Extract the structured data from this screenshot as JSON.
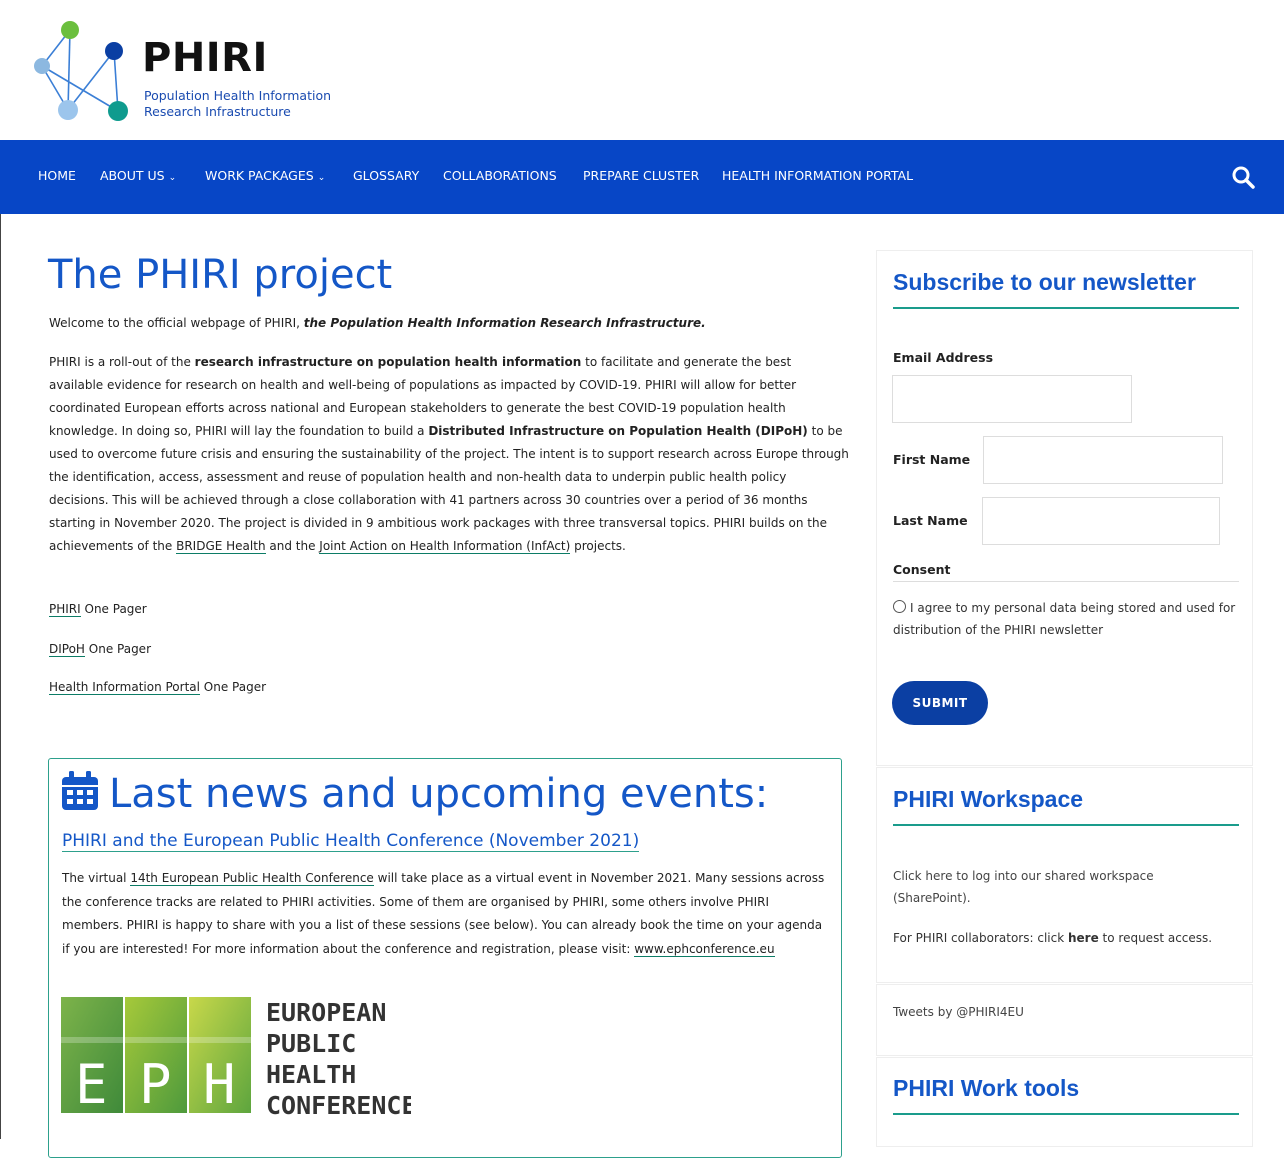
{
  "header": {
    "logo_title": "PHIRI",
    "logo_subtitle_line1": "Population Health Information",
    "logo_subtitle_line2": "Research Infrastructure"
  },
  "nav": {
    "items": [
      {
        "label": "HOME",
        "has_dropdown": false
      },
      {
        "label": "ABOUT US",
        "has_dropdown": true
      },
      {
        "label": "WORK PACKAGES",
        "has_dropdown": true
      },
      {
        "label": "GLOSSARY",
        "has_dropdown": false
      },
      {
        "label": "COLLABORATIONS",
        "has_dropdown": false
      },
      {
        "label": "PREPARE CLUSTER",
        "has_dropdown": false
      },
      {
        "label": "HEALTH INFORMATION PORTAL",
        "has_dropdown": false
      }
    ],
    "chevron": "⌄",
    "search_icon": "search-icon"
  },
  "main": {
    "title": "The PHIRI project",
    "welcome_prefix": "Welcome to the official webpage of PHIRI, ",
    "welcome_emph": "the Population Health Information Research Infrastructure.",
    "para": {
      "t1": "PHIRI is a roll-out of the ",
      "b1": "research infrastructure on population health information",
      "t2": " to facilitate and generate the best available evidence for research on health and well-being of populations as impacted by COVID-19. PHIRI will allow for better coordinated European efforts across national and European stakeholders to generate the best COVID-19 population health knowledge. In doing so, PHIRI will lay the foundation to build a ",
      "b2": "Distributed Infrastructure on Population Health (DIPoH)",
      "t3": " to be used to overcome future crisis and ensuring the sustainability of the project. The intent is to support research across Europe through the identification, access, assessment and reuse of population health and non-health data to underpin public health policy decisions. This will be achieved through a close collaboration with 41 partners across 30 countries over a period of 36 months starting in November 2020. The project is divided in 9 ambitious work packages with three transversal topics. PHIRI builds on the achievements of the ",
      "l1": "BRIDGE Health",
      "t4": " and the ",
      "l2": "Joint Action on Health Information (InfAct)",
      "t5": " projects."
    },
    "one_pagers": [
      {
        "link": "PHIRI",
        "rest": " One Pager"
      },
      {
        "link": "DIPoH",
        "rest": " One Pager"
      },
      {
        "link": "Health Information Portal",
        "rest": " One Pager"
      }
    ]
  },
  "news": {
    "title": "Last news and upcoming events:",
    "icon": "calendar-icon",
    "article_title": "PHIRI and the European Public Health Conference (November 2021)",
    "body_t1": "The virtual ",
    "body_l1": "14th European Public Health Conference",
    "body_t2": " will take place as a virtual event in November 2021. Many sessions across the conference tracks are related to PHIRI activities. Some of them are organised by PHIRI, some others involve PHIRI members. PHIRI is happy to share with you a list of these sessions (see below). You can already book the time on your agenda if you are interested! For more information about the conference and registration, please visit: ",
    "body_l2": "www.ephconference.eu",
    "eph_letters": [
      "E",
      "P",
      "H"
    ],
    "eph_words": [
      "EUROPEAN",
      "PUBLIC",
      "HEALTH",
      "CONFERENCE"
    ]
  },
  "sidebar": {
    "newsletter": {
      "title": "Subscribe to our newsletter",
      "email_label": "Email Address",
      "first_name_label": "First Name",
      "last_name_label": "Last Name",
      "consent_label": "Consent",
      "consent_text": "I agree to my personal data being stored and used for distribution of the PHIRI newsletter",
      "submit_label": "SUBMIT"
    },
    "workspace": {
      "title": "PHIRI Workspace",
      "text1": "Click here to log into our shared workspace (SharePoint).",
      "text2_prefix": "For PHIRI collaborators: click ",
      "text2_bold": "here",
      "text2_suffix": " to request access."
    },
    "tweets": "Tweets by @PHIRI4EU",
    "tools_title": "PHIRI Work tools"
  },
  "colors": {
    "brand_blue": "#0746c6",
    "heading_blue": "#1457c7",
    "teal": "#1a9c8c"
  }
}
